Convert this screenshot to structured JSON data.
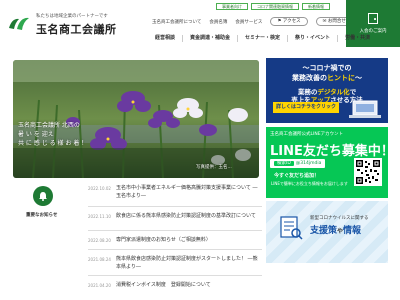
{
  "header": {
    "tagline": "私たちは地域企業のパートナーです",
    "site_name": "玉名商工会議所",
    "util_top": [
      "事業者向け",
      "コロナ関連融資情報",
      "新着情報"
    ],
    "util_links": [
      "玉名商工会議所について",
      "会員名簿",
      "会員サービス"
    ],
    "access_label": "アクセス",
    "contact_label": "お問合せ",
    "entry_button": "入会のご案内"
  },
  "global_nav": [
    "経営相談",
    "資金調達・補助金",
    "セミナー・検定",
    "祭り・イベント",
    "労働・共済"
  ],
  "hero": {
    "caption_line1": "玉名商工会議所 北西の",
    "caption_line2": "暑 い を 迎え",
    "caption_line3": "共 に 感 じ る 様 お 着 ！",
    "credit": "写真提供：玉名..."
  },
  "banner_dx": {
    "line1": "〜コロナ禍での",
    "line2_a": "業務改善の",
    "line2_b": "ヒントに",
    "line2_c": "〜",
    "line3_a": "業務の",
    "line3_b": "デジタル化",
    "line3_c": "で",
    "line4_a": "売上を",
    "line4_b": "アップ",
    "line4_c": "させる方法",
    "button": "詳しくはコチラをクリック"
  },
  "banner_line": {
    "line1": "玉名商工会議所公式LINEアカウント",
    "line2": "LINE友だち募集中！",
    "id_key": "検索ID",
    "id_value": "@314jmdia",
    "line3": "今すぐ友だち追加！",
    "line4": "LINEで簡単にお役立ち情報をお届けします"
  },
  "banner_support": {
    "line1": "新型コロナウイルスに関する",
    "line2_a": "支援策",
    "line2_b": "や",
    "line2_c": "情報"
  },
  "news": {
    "label": "重要なお知らせ",
    "items": [
      {
        "date": "2022.10.02",
        "title": "玉名市中小事業者エネルギー価格高騰対策支援事業について ―玉名市より―"
      },
      {
        "date": "2022.11.10",
        "title": "飲食店に係る熊本県感染防止対策認証制度の基準改訂について"
      },
      {
        "date": "2022.08.20",
        "title": "専門家派遣制度のお知らせ（ご相談無料）"
      },
      {
        "date": "2021.08.24",
        "title": "熊本県飲食店感染防止対策認証制度がスタートしました！ ―熊本県より―"
      },
      {
        "date": "2021.04.20",
        "title": "消費税インボイス制度　登録開始について"
      }
    ]
  },
  "colors": {
    "brand_green": "#1e7a34",
    "line_green": "#06c755",
    "banner_navy": "#153a86",
    "accent_yellow": "#ffd400"
  }
}
